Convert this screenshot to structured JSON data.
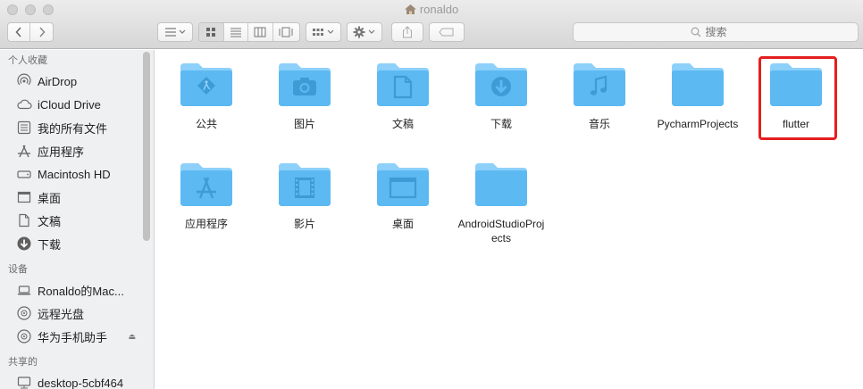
{
  "window": {
    "title": "ronaldo"
  },
  "toolbar": {
    "search_placeholder": "搜索",
    "back_icon": "chevron-left-icon",
    "forward_icon": "chevron-right-icon"
  },
  "sidebar": {
    "favorites_header": "个人收藏",
    "favorites": [
      {
        "label": "AirDrop",
        "icon": "airdrop-icon"
      },
      {
        "label": "iCloud Drive",
        "icon": "cloud-icon"
      },
      {
        "label": "我的所有文件",
        "icon": "all-files-icon"
      },
      {
        "label": "应用程序",
        "icon": "applications-icon"
      },
      {
        "label": "Macintosh HD",
        "icon": "hard-drive-icon"
      },
      {
        "label": "桌面",
        "icon": "desktop-icon"
      },
      {
        "label": "文稿",
        "icon": "document-icon"
      },
      {
        "label": "下载",
        "icon": "download-icon"
      }
    ],
    "devices_header": "设备",
    "devices": [
      {
        "label": "Ronaldo的Mac...",
        "icon": "laptop-icon"
      },
      {
        "label": "远程光盘",
        "icon": "disc-icon"
      },
      {
        "label": "华为手机助手",
        "icon": "disc-icon",
        "eject": "⏏"
      }
    ],
    "shared_header": "共享的",
    "shared": [
      {
        "label": "desktop-5cbf464",
        "icon": "network-computer-icon"
      }
    ]
  },
  "content": {
    "folders": [
      {
        "label": "公共",
        "glyph": "public"
      },
      {
        "label": "图片",
        "glyph": "camera"
      },
      {
        "label": "文稿",
        "glyph": "document"
      },
      {
        "label": "下载",
        "glyph": "download"
      },
      {
        "label": "音乐",
        "glyph": "music"
      },
      {
        "label": "PycharmProjects",
        "glyph": "none"
      },
      {
        "label": "flutter",
        "glyph": "none",
        "highlighted": true
      },
      {
        "label": "应用程序",
        "glyph": "apps"
      },
      {
        "label": "影片",
        "glyph": "film"
      },
      {
        "label": "桌面",
        "glyph": "desktop"
      },
      {
        "label": "AndroidStudioProjects",
        "glyph": "none"
      }
    ]
  },
  "colors": {
    "folder": "#5cb9f2",
    "folder_tab": "#8dd0fa",
    "highlight": "#e51e1e"
  }
}
